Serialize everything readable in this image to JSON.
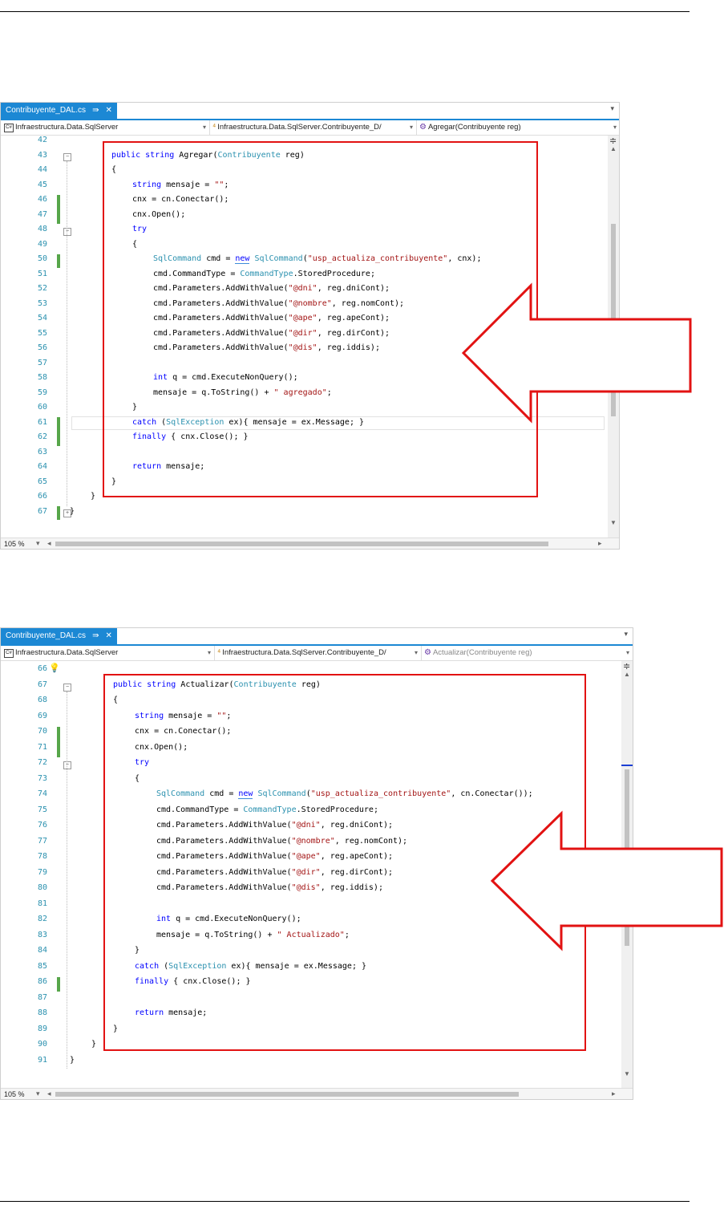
{
  "panels": [
    {
      "tab_label": "Contribuyente_DAL.cs",
      "nav": {
        "project": "Infraestructura.Data.SqlServer",
        "class": "Infraestructura.Data.SqlServer.Contribuyente_D/",
        "method": "Agregar(Contribuyente reg)"
      },
      "zoom": "105 %",
      "lines": [
        "42",
        "43",
        "44",
        "45",
        "46",
        "47",
        "48",
        "49",
        "50",
        "51",
        "52",
        "53",
        "54",
        "55",
        "56",
        "57",
        "58",
        "59",
        "60",
        "61",
        "62",
        "63",
        "64",
        "65",
        "66",
        "67"
      ]
    },
    {
      "tab_label": "Contribuyente_DAL.cs",
      "nav": {
        "project": "Infraestructura.Data.SqlServer",
        "class": "Infraestructura.Data.SqlServer.Contribuyente_D/",
        "method": "Actualizar(Contribuyente reg)"
      },
      "zoom": "105 %",
      "lines": [
        "66",
        "67",
        "68",
        "69",
        "70",
        "71",
        "72",
        "73",
        "74",
        "75",
        "76",
        "77",
        "78",
        "79",
        "80",
        "81",
        "82",
        "83",
        "84",
        "85",
        "86",
        "87",
        "88",
        "89",
        "90",
        "91"
      ]
    }
  ],
  "code1": {
    "sig_kw": "public string",
    "sig_name": " Agregar(",
    "sig_type": "Contribuyente",
    "sig_rest": " reg)",
    "brace_open": "{",
    "l45_kw": "string",
    "l45_rest": " mensaje = ",
    "l45_str": "\"\"",
    "l45_end": ";",
    "l46": "cnx = cn.Conectar();",
    "l47": "cnx.Open();",
    "l48": "try",
    "l49": "{",
    "l50_ty": "SqlCommand",
    "l50_a": " cmd = ",
    "l50_new": "new",
    "l50_b": " ",
    "l50_ty2": "SqlCommand",
    "l50_c": "(",
    "l50_str": "\"usp_actualiza_contribuyente\"",
    "l50_d": ", cnx);",
    "l51_a": "cmd.CommandType = ",
    "l51_ty": "CommandType",
    "l51_b": ".StoredProcedure;",
    "p1_a": "cmd.Parameters.AddWithValue(",
    "p1_s": "\"@dni\"",
    "p1_b": ", reg.dniCont);",
    "p2_a": "cmd.Parameters.AddWithValue(",
    "p2_s": "\"@nombre\"",
    "p2_b": ", reg.nomCont);",
    "p3_a": "cmd.Parameters.AddWithValue(",
    "p3_s": "\"@ape\"",
    "p3_b": ", reg.apeCont);",
    "p4_a": "cmd.Parameters.AddWithValue(",
    "p4_s": "\"@dir\"",
    "p4_b": ", reg.dirCont);",
    "p5_a": "cmd.Parameters.AddWithValue(",
    "p5_s": "\"@dis\"",
    "p5_b": ", reg.iddis);",
    "l58_kw": "int",
    "l58_rest": " q = cmd.ExecuteNonQuery();",
    "l59_a": "mensaje = q.ToString() + ",
    "l59_s": "\" agregado\"",
    "l59_b": ";",
    "l60": "}",
    "l61_kw": "catch",
    "l61_a": " (",
    "l61_ty": "SqlException",
    "l61_b": " ex){ mensaje = ex.Message; }",
    "l62_kw": "finally",
    "l62_b": " { cnx.Close(); }",
    "l64_kw": "return",
    "l64_b": " mensaje;",
    "l65": "}",
    "l66": "}",
    "l67": "}"
  },
  "code2": {
    "sig_kw": "public string",
    "sig_name": " Actualizar(",
    "sig_type": "Contribuyente",
    "sig_rest": " reg)",
    "brace_open": "{",
    "l69_kw": "string",
    "l69_rest": " mensaje = ",
    "l69_str": "\"\"",
    "l69_end": ";",
    "l70": "cnx = cn.Conectar();",
    "l71": "cnx.Open();",
    "l72": "try",
    "l73": "{",
    "l74_ty": "SqlCommand",
    "l74_a": " cmd = ",
    "l74_new": "new",
    "l74_b": " ",
    "l74_ty2": "SqlCommand",
    "l74_c": "(",
    "l74_str": "\"usp_actualiza_contribuyente\"",
    "l74_d": ", cn.Conectar());",
    "l75_a": "cmd.CommandType = ",
    "l75_ty": "CommandType",
    "l75_b": ".StoredProcedure;",
    "p1_a": "cmd.Parameters.AddWithValue(",
    "p1_s": "\"@dni\"",
    "p1_b": ", reg.dniCont);",
    "p2_a": "cmd.Parameters.AddWithValue(",
    "p2_s": "\"@nombre\"",
    "p2_b": ", reg.nomCont);",
    "p3_a": "cmd.Parameters.AddWithValue(",
    "p3_s": "\"@ape\"",
    "p3_b": ", reg.apeCont);",
    "p4_a": "cmd.Parameters.AddWithValue(",
    "p4_s": "\"@dir\"",
    "p4_b": ", reg.dirCont);",
    "p5_a": "cmd.Parameters.AddWithValue(",
    "p5_s": "\"@dis\"",
    "p5_b": ", reg.iddis);",
    "l82_kw": "int",
    "l82_rest": " q = cmd.ExecuteNonQuery();",
    "l83_a": "mensaje = q.ToString() + ",
    "l83_s": "\" Actualizado\"",
    "l83_b": ";",
    "l84": "}",
    "l85_kw": "catch",
    "l85_a": " (",
    "l85_ty": "SqlException",
    "l85_b": " ex){ mensaje = ex.Message; }",
    "l86_kw": "finally",
    "l86_b": " { cnx.Close(); }",
    "l88_kw": "return",
    "l88_b": " mensaje;",
    "l89": "}",
    "l90": "}",
    "l91": "}"
  },
  "colors": {
    "accent": "#1c88d4",
    "highlight": "#e21212",
    "change_bar": "#57a64a"
  }
}
